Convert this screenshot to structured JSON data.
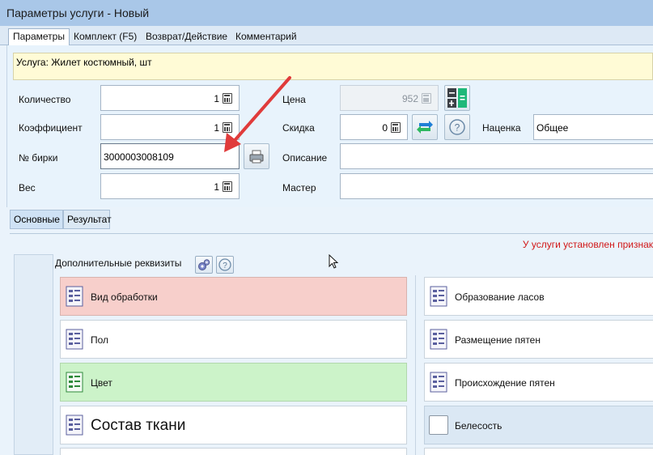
{
  "window": {
    "title": "Параметры услуги - Новый"
  },
  "tabs": [
    {
      "label": "Параметры",
      "active": true
    },
    {
      "label": "Комплект (F5)"
    },
    {
      "label": "Возврат/Действие"
    },
    {
      "label": "Комментарий"
    }
  ],
  "service": {
    "text": "Услуга: Жилет костюмный, шт"
  },
  "form": {
    "quantity": {
      "label": "Количество",
      "value": "1"
    },
    "coefficient": {
      "label": "Коэффициент",
      "value": "1"
    },
    "tag": {
      "label": "№ бирки",
      "value": "3000003008109"
    },
    "weight": {
      "label": "Вес",
      "value": "1"
    },
    "price": {
      "label": "Цена",
      "value": "952"
    },
    "discount": {
      "label": "Скидка",
      "value": "0"
    },
    "markup": {
      "label": "Наценка",
      "value": "Общее"
    },
    "description": {
      "label": "Описание",
      "value": ""
    },
    "master": {
      "label": "Мастер",
      "value": ""
    }
  },
  "subtabs": [
    {
      "label": "Основные",
      "active": true
    },
    {
      "label": "Результат"
    }
  ],
  "notice": "У услуги установлен признак",
  "additional": {
    "title": "Дополнительные реквизиты",
    "left_cards": [
      {
        "label": "Вид обработки",
        "state": "pink"
      },
      {
        "label": "Пол",
        "state": "white"
      },
      {
        "label": "Цвет",
        "state": "green"
      },
      {
        "label": "Состав ткани",
        "state": "white"
      }
    ],
    "right_cards": [
      {
        "label": "Образование ласов",
        "state": "white"
      },
      {
        "label": "Размещение пятен",
        "state": "white"
      },
      {
        "label": "Происхождение пятен",
        "state": "white"
      },
      {
        "label": "Белесость",
        "state": "blue"
      }
    ]
  },
  "colors": {
    "accent_red": "#e03b3b",
    "pink": "#f7cfcb",
    "green": "#ccf3c9",
    "notice": "#d11717"
  }
}
